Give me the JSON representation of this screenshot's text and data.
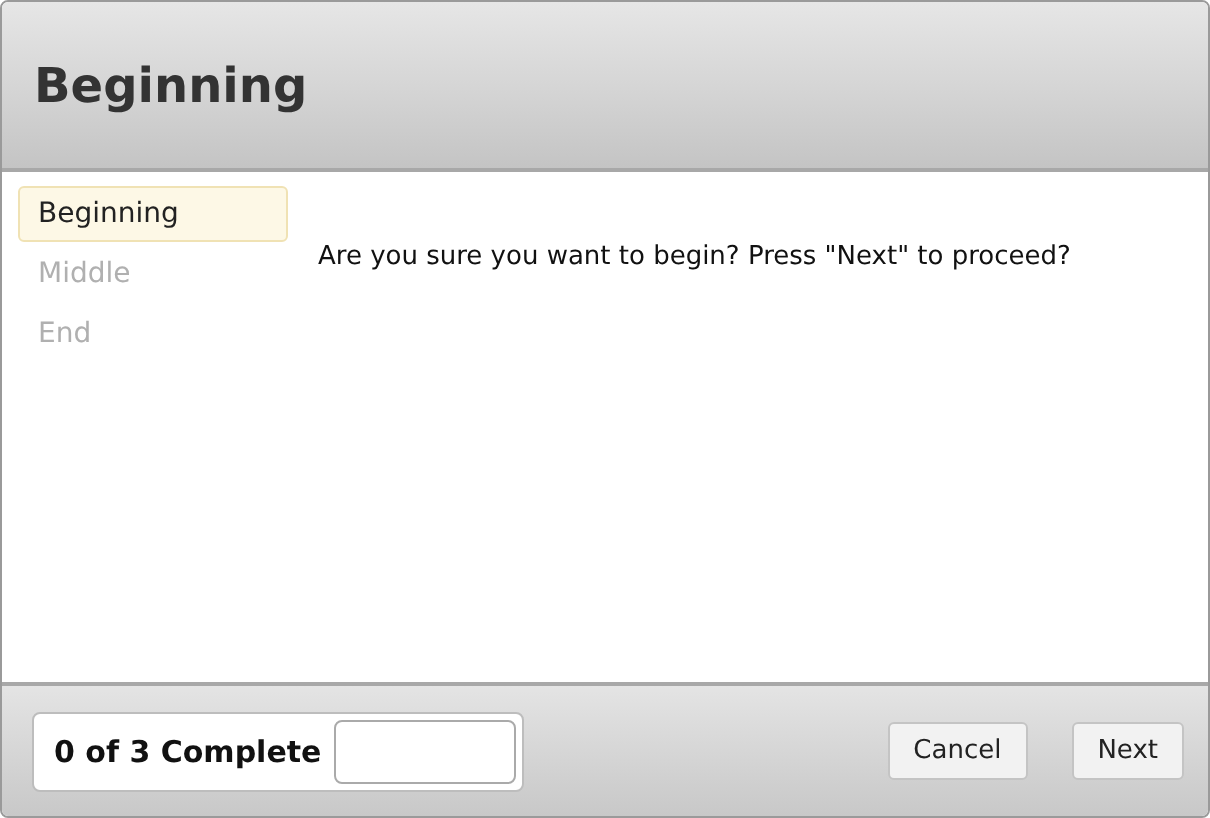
{
  "header": {
    "title": "Beginning"
  },
  "steps": [
    {
      "label": "Beginning",
      "selected": true
    },
    {
      "label": "Middle",
      "selected": false
    },
    {
      "label": "End",
      "selected": false
    }
  ],
  "content": {
    "text": "Are you sure you want to begin? Press \"Next\" to proceed?"
  },
  "footer": {
    "status": "0 of 3 Complete",
    "progress": {
      "level": 0
    },
    "buttons": [
      {
        "label": "Cancel"
      },
      {
        "label": "Next"
      }
    ]
  }
}
